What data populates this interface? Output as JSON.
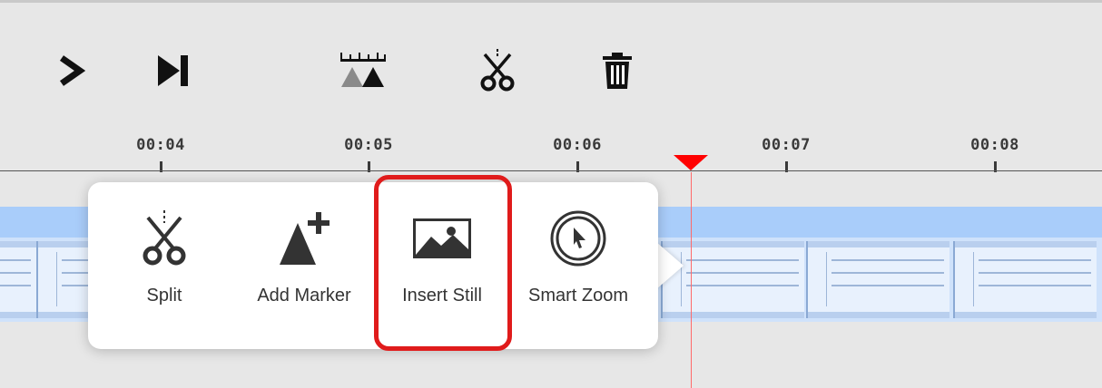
{
  "toolbar": {
    "buttons": [
      {
        "name": "play-icon"
      },
      {
        "name": "next-frame-icon"
      },
      {
        "name": "add-marker-ruler-icon"
      },
      {
        "name": "split-scissors-icon"
      },
      {
        "name": "trash-icon"
      }
    ]
  },
  "timeline": {
    "ticks": [
      "00:04",
      "00:05",
      "00:06",
      "00:07",
      "00:08"
    ],
    "playhead_color": "#ff0000",
    "track_color": "#a9cdfa"
  },
  "popover": {
    "items": [
      {
        "label": "Split",
        "icon": "scissors-icon"
      },
      {
        "label": "Add Marker",
        "icon": "add-marker-icon"
      },
      {
        "label": "Insert Still",
        "icon": "image-icon"
      },
      {
        "label": "Smart Zoom",
        "icon": "cursor-circle-icon"
      }
    ],
    "highlighted_item": "Insert Still",
    "highlight_color": "#e01b1b"
  }
}
